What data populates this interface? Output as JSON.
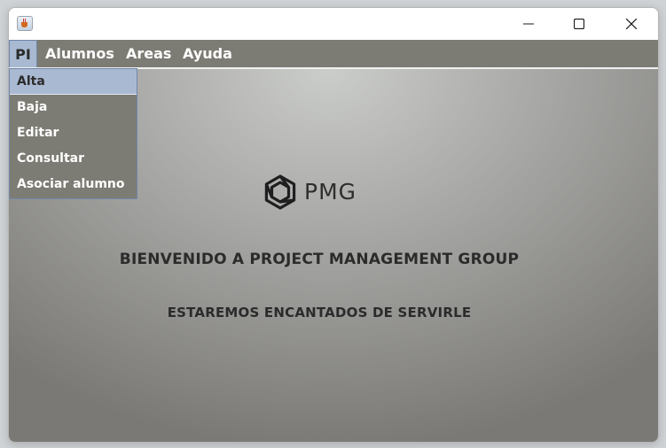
{
  "window": {
    "title": "",
    "controls": {
      "minimize_icon": "minimize-icon",
      "maximize_icon": "maximize-icon",
      "close_icon": "close-icon"
    }
  },
  "menubar": {
    "items": [
      {
        "label": "PI",
        "active": true
      },
      {
        "label": "Alumnos"
      },
      {
        "label": "Areas"
      },
      {
        "label": "Ayuda"
      }
    ]
  },
  "dropdown": {
    "items": [
      {
        "label": "Alta",
        "selected": true
      },
      {
        "label": "Baja"
      },
      {
        "label": "Editar"
      },
      {
        "label": "Consultar"
      },
      {
        "label": "Asociar alumno"
      }
    ]
  },
  "main": {
    "logo_text": "PMG",
    "headline": "BIENVENIDO A PROJECT MANAGEMENT GROUP",
    "subline": "ESTAREMOS ENCANTADOS DE SERVIRLE"
  },
  "colors": {
    "menubar_bg": "#7d7c74",
    "selection_bg": "#a9b9d1",
    "text_dark": "#2b2b2b"
  }
}
